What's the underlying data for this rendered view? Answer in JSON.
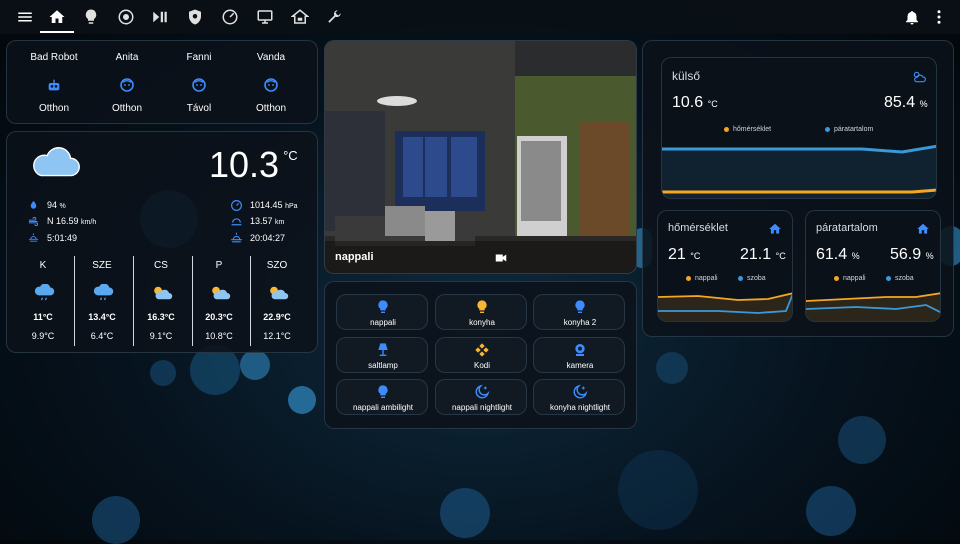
{
  "colors": {
    "accent": "#3d8bfd",
    "orange": "#f5a623",
    "blue": "#3a9ad9",
    "bulb_on": "#f7b731"
  },
  "topbar": {
    "icons": [
      "menu-icon",
      "home-icon",
      "lightbulb-icon",
      "robot-vacuum-icon",
      "play-pause-icon",
      "shield-icon",
      "gauge-icon",
      "monitor-icon",
      "house-network-icon",
      "wrench-icon"
    ],
    "right_icons": [
      "bell-icon",
      "dots-vertical-icon"
    ]
  },
  "people": [
    {
      "name": "Bad Robot",
      "state": "Otthon",
      "icon": "robot-icon"
    },
    {
      "name": "Anita",
      "state": "Otthon",
      "icon": "face-icon"
    },
    {
      "name": "Fanni",
      "state": "Távol",
      "icon": "face-icon"
    },
    {
      "name": "Vanda",
      "state": "Otthon",
      "icon": "face-icon"
    }
  ],
  "weather": {
    "temp": "10.3",
    "temp_unit": "°C",
    "icon": "cloudy-icon",
    "humidity": "94",
    "humidity_unit": "%",
    "wind": "N 16.59",
    "wind_unit": "km/h",
    "sunrise": "5:01:49",
    "pressure": "1014.45",
    "pressure_unit": "hPa",
    "visibility": "13.57",
    "visibility_unit": "km",
    "sunset": "20:04:27",
    "forecast": [
      {
        "day": "K",
        "icon": "rain-icon",
        "high": "11°C",
        "low": "9.9°C"
      },
      {
        "day": "SZE",
        "icon": "rain-icon",
        "high": "13.4°C",
        "low": "6.4°C"
      },
      {
        "day": "CS",
        "icon": "partly-cloudy-icon",
        "high": "16.3°C",
        "low": "9.1°C"
      },
      {
        "day": "P",
        "icon": "partly-cloudy-icon",
        "high": "20.3°C",
        "low": "10.8°C"
      },
      {
        "day": "SZO",
        "icon": "partly-cloudy-icon",
        "high": "22.9°C",
        "low": "12.1°C"
      }
    ]
  },
  "camera": {
    "label": "nappali",
    "icon": "video-icon"
  },
  "buttons": [
    {
      "label": "nappali",
      "icon": "lightbulb-icon",
      "on": false
    },
    {
      "label": "konyha",
      "icon": "lightbulb-icon",
      "on": true
    },
    {
      "label": "konyha 2",
      "icon": "lightbulb-icon",
      "on": false
    },
    {
      "label": "saltlamp",
      "icon": "lamp-icon",
      "on": false
    },
    {
      "label": "Kodi",
      "icon": "kodi-icon",
      "on": true
    },
    {
      "label": "kamera",
      "icon": "webcam-icon",
      "on": false
    },
    {
      "label": "nappali ambilight",
      "icon": "lightbulb-icon",
      "on": false
    },
    {
      "label": "nappali nightlight",
      "icon": "moon-star-icon",
      "on": false
    },
    {
      "label": "konyha nightlight",
      "icon": "moon-star-icon",
      "on": false
    }
  ],
  "kulso": {
    "title": "külső",
    "temp": "10.6",
    "temp_unit": "°C",
    "hum": "85.4",
    "hum_unit": "%",
    "legend_a": "hőmérséklet",
    "legend_b": "páratartalom",
    "icon": "weather-partly-icon"
  },
  "homerseklet": {
    "title": "hőmérséklet",
    "a": "21",
    "a_unit": "°C",
    "b": "21.1",
    "b_unit": "°C",
    "legend_a": "nappali",
    "legend_b": "szoba",
    "icon": "home-icon"
  },
  "paratartalom": {
    "title": "páratartalom",
    "a": "61.4",
    "a_unit": "%",
    "b": "56.9",
    "b_unit": "%",
    "legend_a": "nappali",
    "legend_b": "szoba",
    "icon": "home-icon"
  }
}
